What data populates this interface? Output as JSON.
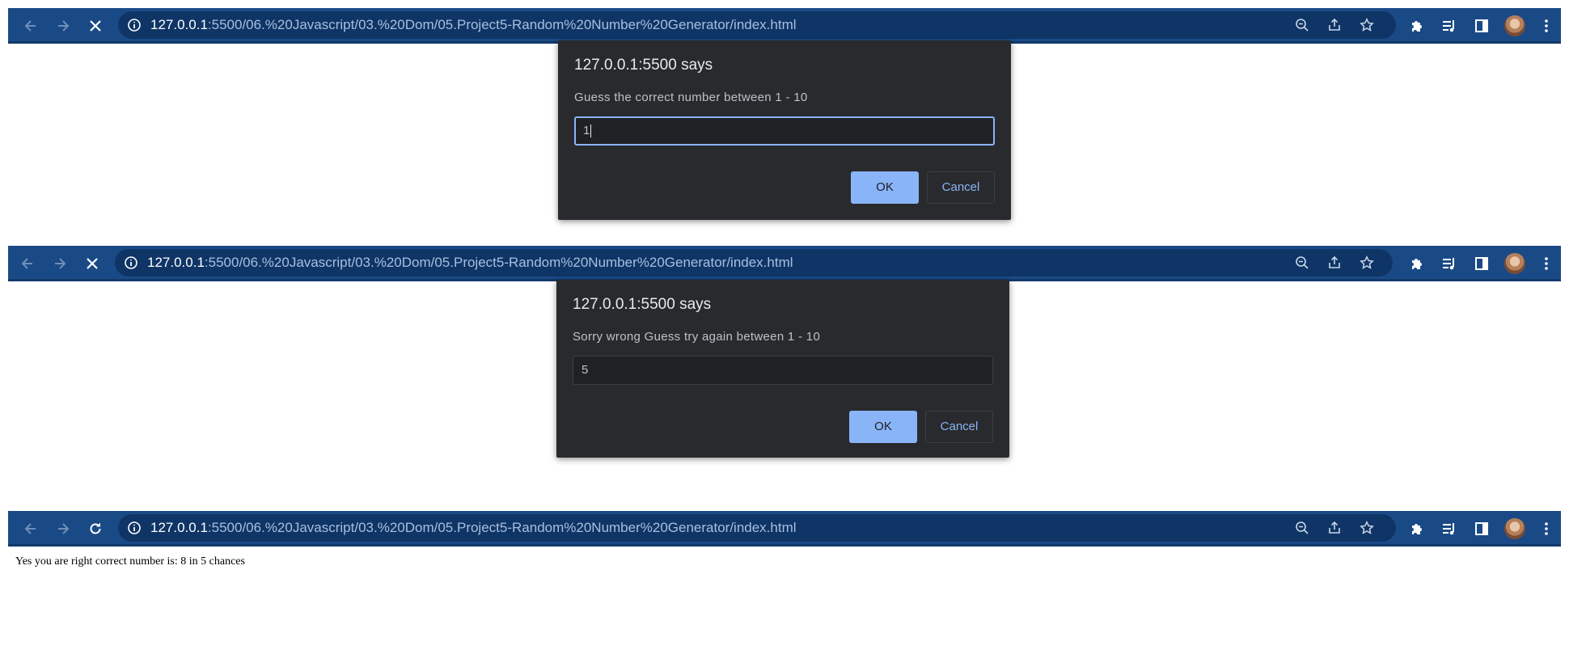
{
  "colors": {
    "toolbar_bg": "#1a4a86",
    "omnibox_bg": "#0f3566",
    "dialog_bg": "#292a2d",
    "accent": "#8ab4f8"
  },
  "windows": [
    {
      "reload_icon": "stop-icon",
      "url_host": "127.0.0.1",
      "url_rest": ":5500/06.%20Javascript/03.%20Dom/05.Project5-Random%20Number%20Generator/index.html",
      "dialog": {
        "title": "127.0.0.1:5500 says",
        "message": "Guess the correct number between 1 - 10",
        "input_value": "1",
        "ok_label": "OK",
        "cancel_label": "Cancel"
      }
    },
    {
      "reload_icon": "stop-icon",
      "url_host": "127.0.0.1",
      "url_rest": ":5500/06.%20Javascript/03.%20Dom/05.Project5-Random%20Number%20Generator/index.html",
      "dialog": {
        "title": "127.0.0.1:5500 says",
        "message": "Sorry wrong Guess try again between 1 - 10",
        "input_value": "5",
        "ok_label": "OK",
        "cancel_label": "Cancel"
      }
    },
    {
      "reload_icon": "reload-icon",
      "url_host": "127.0.0.1",
      "url_rest": ":5500/06.%20Javascript/03.%20Dom/05.Project5-Random%20Number%20Generator/index.html",
      "page_text": "Yes you are right correct number is: 8 in 5 chances"
    }
  ]
}
